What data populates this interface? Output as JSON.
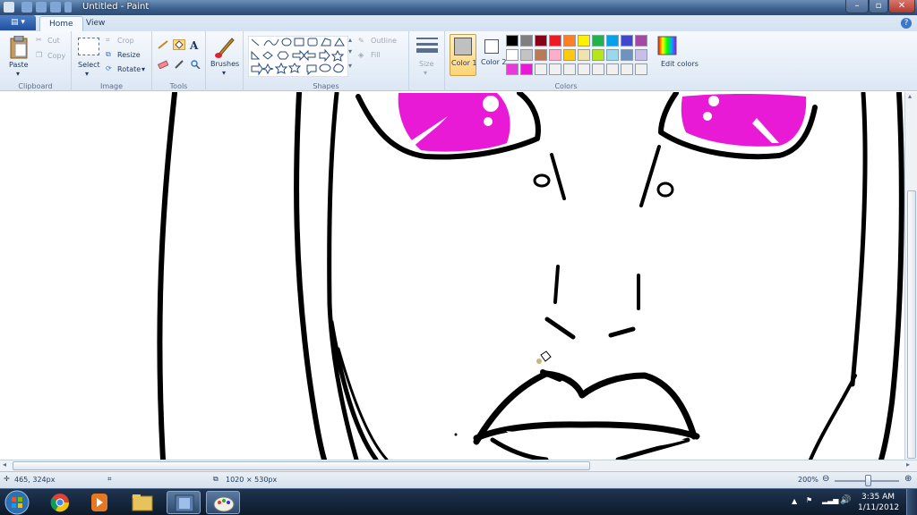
{
  "window": {
    "title": "Untitled - Paint"
  },
  "tabs": [
    {
      "label": "Home"
    },
    {
      "label": "View"
    }
  ],
  "ribbon": {
    "clipboard": {
      "paste": "Paste",
      "cut": "Cut",
      "copy": "Copy",
      "group": "Clipboard"
    },
    "image": {
      "select": "Select",
      "crop": "Crop",
      "resize": "Resize",
      "rotate": "Rotate",
      "group": "Image"
    },
    "tools": {
      "group": "Tools"
    },
    "brushes": {
      "label": "Brushes"
    },
    "shapes": {
      "outline": "Outline",
      "fill": "Fill",
      "group": "Shapes"
    },
    "size": {
      "label": "Size"
    },
    "colors": {
      "color1": "Color 1",
      "color2": "Color 2",
      "edit": "Edit colors",
      "group": "Colors",
      "color1_value": "#c0c0c0",
      "color2_value": "#ffffff",
      "palette": [
        "#000000",
        "#7f7f7f",
        "#880015",
        "#ed1c24",
        "#ff7f27",
        "#fff200",
        "#22b14c",
        "#00a2e8",
        "#3f48cc",
        "#a349a4",
        "#ffffff",
        "#c3c3c3",
        "#b97a57",
        "#ffaec9",
        "#ffc90e",
        "#efe4b0",
        "#b5e61d",
        "#99d9ea",
        "#7092be",
        "#c8bfe7",
        "#e83ad6",
        "#e81ad6",
        "#f0f0f0",
        "#f0f0f0",
        "#f0f0f0",
        "#f0f0f0",
        "#f0f0f0",
        "#f0f0f0",
        "#f0f0f0",
        "#f0f0f0"
      ]
    }
  },
  "status": {
    "cursor": "465, 324px",
    "canvas_size": "1020 × 530px",
    "zoom": "200%"
  },
  "taskbar": {
    "time": "3:35 AM",
    "date": "1/11/2012"
  }
}
